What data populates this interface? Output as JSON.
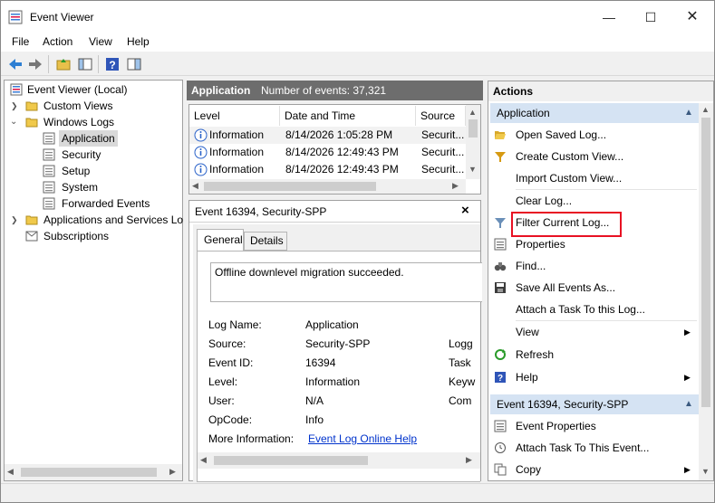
{
  "window": {
    "title": "Event Viewer"
  },
  "menu": {
    "file": "File",
    "action": "Action",
    "view": "View",
    "help": "Help"
  },
  "tree": {
    "root": "Event Viewer (Local)",
    "custom_views": "Custom Views",
    "windows_logs": "Windows Logs",
    "application": "Application",
    "security": "Security",
    "setup": "Setup",
    "system": "System",
    "forwarded_events": "Forwarded Events",
    "apps_services": "Applications and Services Lo",
    "subscriptions": "Subscriptions"
  },
  "log_header": {
    "name": "Application",
    "count": "Number of events: 37,321"
  },
  "columns": {
    "level": "Level",
    "date_time": "Date and Time",
    "source": "Source"
  },
  "events": [
    {
      "level": "Information",
      "date": "8/14/2026 1:05:28 PM",
      "source": "Securit..."
    },
    {
      "level": "Information",
      "date": "8/14/2026 12:49:43 PM",
      "source": "Securit..."
    },
    {
      "level": "Information",
      "date": "8/14/2026 12:49:43 PM",
      "source": "Securit..."
    }
  ],
  "detail": {
    "title": "Event 16394, Security-SPP",
    "close": "×",
    "tab_general": "General",
    "tab_details": "Details",
    "message": "Offline downlevel migration succeeded.",
    "log_name_label": "Log Name:",
    "log_name": "Application",
    "source_label": "Source:",
    "source": "Security-SPP",
    "event_id_label": "Event ID:",
    "event_id": "16394",
    "level_label": "Level:",
    "level": "Information",
    "user_label": "User:",
    "user": "N/A",
    "opcode_label": "OpCode:",
    "opcode": "Info",
    "more_info_label": "More Information:",
    "more_info_link": "Event Log Online Help",
    "col2_logged": "Logg",
    "col2_task": "Task",
    "col2_keywords": "Keyw",
    "col2_computer": "Com"
  },
  "actions": {
    "title": "Actions",
    "section_app": "Application",
    "items_app": [
      "Open Saved Log...",
      "Create Custom View...",
      "Import Custom View...",
      "Clear Log...",
      "Filter Current Log...",
      "Properties",
      "Find...",
      "Save All Events As...",
      "Attach a Task To this Log...",
      "View",
      "Refresh",
      "Help"
    ],
    "section_event": "Event 16394, Security-SPP",
    "items_event": [
      "Event Properties",
      "Attach Task To This Event...",
      "Copy"
    ]
  },
  "colors": {
    "highlight_box": "#e81123",
    "section_bg": "#d5e3f3",
    "dark_header": "#6d6d6d"
  }
}
